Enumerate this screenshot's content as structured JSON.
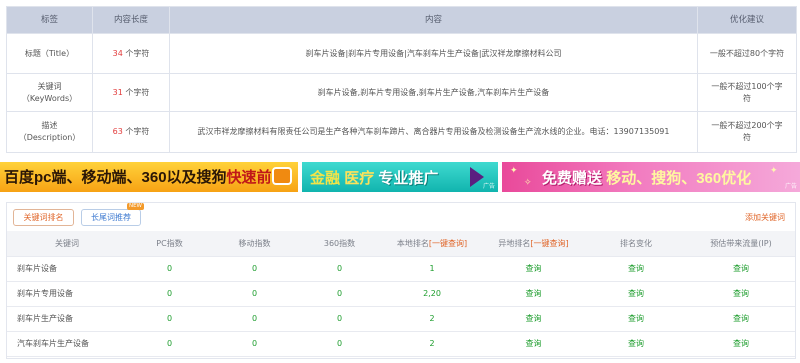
{
  "seo_table": {
    "headers": [
      "标签",
      "内容长度",
      "内容",
      "优化建议"
    ],
    "rows": [
      {
        "label_line1": "标题（Title）",
        "label_line2": "",
        "length_num": "34",
        "length_unit": " 个字符",
        "content": "刹车片设备|刹车片专用设备|汽车刹车片生产设备|武汉祥龙摩擦材料公司",
        "advice": "一般不超过80个字符"
      },
      {
        "label_line1": "关键词",
        "label_line2": "（KeyWords）",
        "length_num": "31",
        "length_unit": " 个字符",
        "content": "刹车片设备,刹车片专用设备,刹车片生产设备,汽车刹车片生产设备",
        "advice": "一般不超过100个字符"
      },
      {
        "label_line1": "描述",
        "label_line2": "（Description）",
        "length_num": "63",
        "length_unit": " 个字符",
        "content": "武汉市祥龙摩擦材料有限责任公司是生产各种汽车刹车蹄片、离合器片专用设备及检测设备生产流水线的企业。电话：13907135091",
        "advice": "一般不超过200个字符"
      }
    ]
  },
  "banners": {
    "ad1": {
      "text_a": "百度pc端、移动端、360以及搜狗",
      "text_b": "快速前三"
    },
    "ad2": {
      "text_a": "金融",
      "text_b": "医疗",
      "text_c": "专业推广",
      "tag": "广告"
    },
    "ad3": {
      "text_a": "免费赠送",
      "text_b": "移动、搜狗、360优化",
      "tag": "广告"
    }
  },
  "ranking": {
    "tab_active": "关键词排名",
    "tab_second": "长尾词推荐",
    "tab_badge": "NEW",
    "add_link": "添加关键词",
    "headers": {
      "keyword": "关键词",
      "pc": "PC指数",
      "mobile": "移动指数",
      "s360": "360指数",
      "local_prefix": "本地排名",
      "local_link": "[一键查询]",
      "remote_prefix": "异地排名",
      "remote_link": "[一键查询]",
      "change": "排名变化",
      "traffic": "预估带来流量(IP)"
    },
    "rows": [
      {
        "keyword": "刹车片设备",
        "pc": "0",
        "mobile": "0",
        "s360": "0",
        "local": "1",
        "remote": "查询",
        "change": "查询",
        "traffic": "查询"
      },
      {
        "keyword": "刹车片专用设备",
        "pc": "0",
        "mobile": "0",
        "s360": "0",
        "local": "2,20",
        "remote": "查询",
        "change": "查询",
        "traffic": "查询"
      },
      {
        "keyword": "刹车片生产设备",
        "pc": "0",
        "mobile": "0",
        "s360": "0",
        "local": "2",
        "remote": "查询",
        "change": "查询",
        "traffic": "查询"
      },
      {
        "keyword": "汽车刹车片生产设备",
        "pc": "0",
        "mobile": "0",
        "s360": "0",
        "local": "2",
        "remote": "查询",
        "change": "查询",
        "traffic": "查询"
      }
    ]
  },
  "colors": {
    "header_bg": "#c9d0e0",
    "accent_orange": "#e0662a",
    "number_red": "#e23d3d",
    "value_green": "#1d9d2d"
  }
}
